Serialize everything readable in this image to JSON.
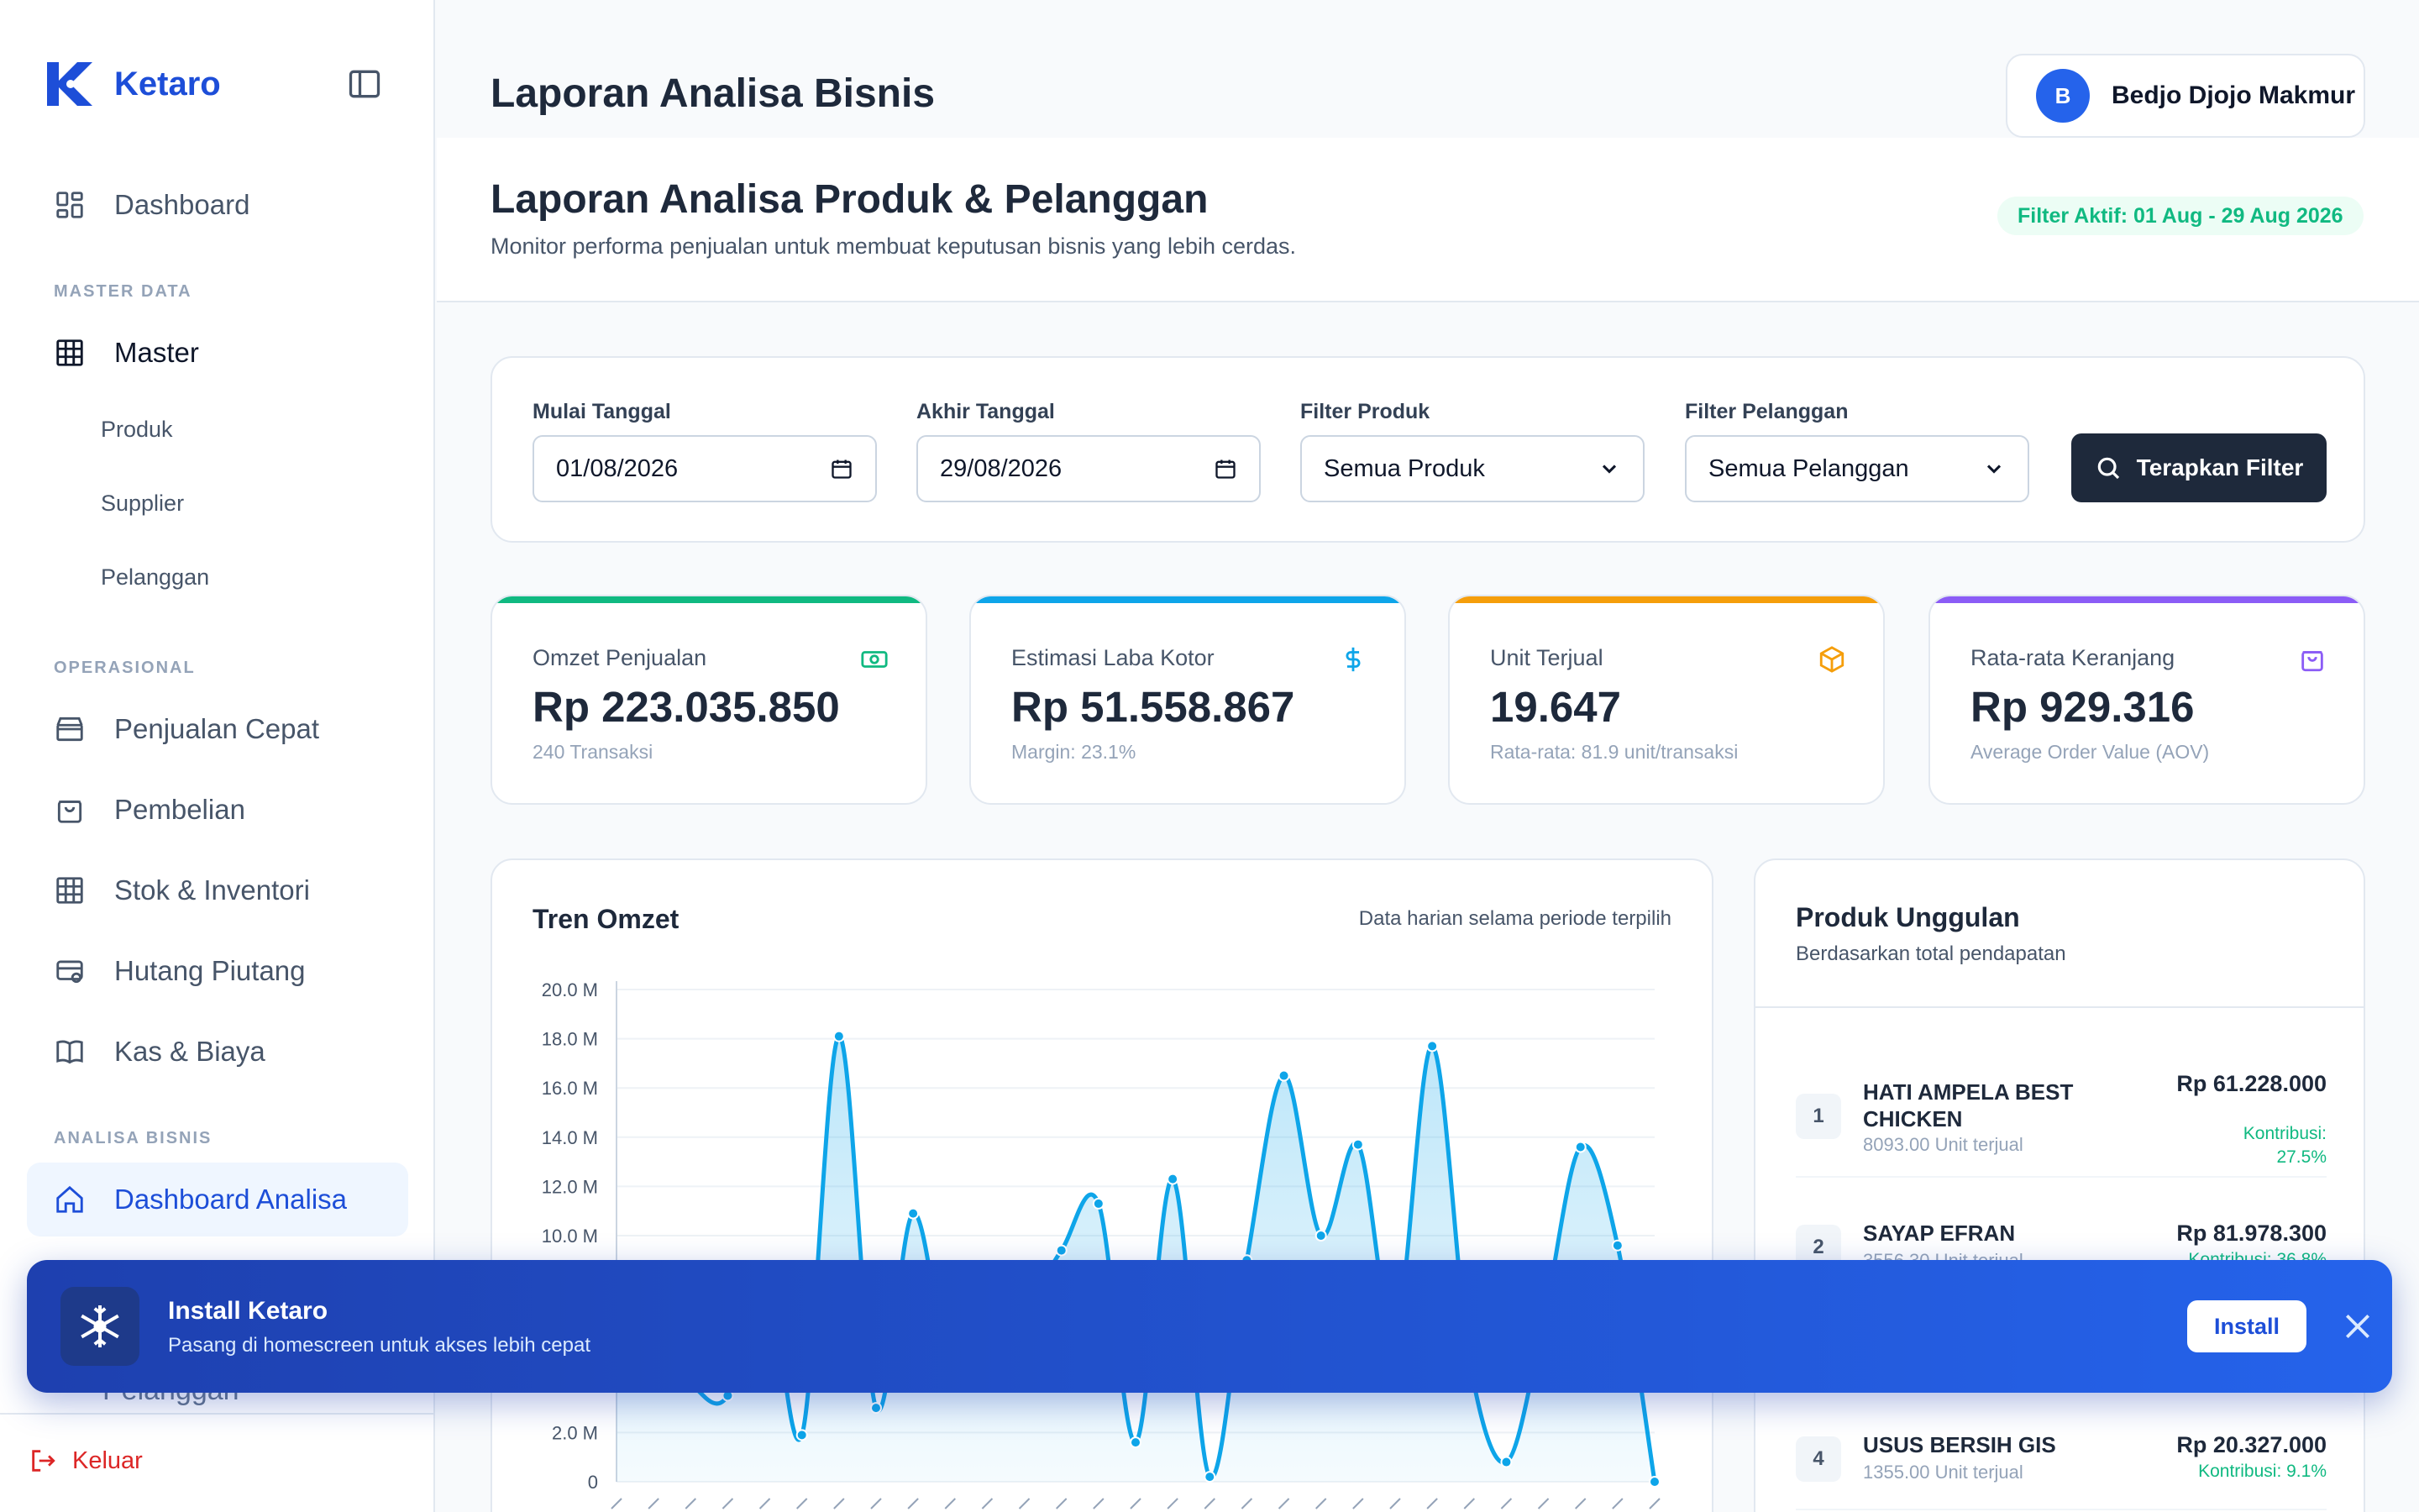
{
  "brand": {
    "name": "Ketaro"
  },
  "sidebar": {
    "dashboard": "Dashboard",
    "section_master": "MASTER DATA",
    "master": "Master",
    "master_sub": [
      "Produk",
      "Supplier",
      "Pelanggan"
    ],
    "section_operasional": "OPERASIONAL",
    "operasional": [
      "Penjualan Cepat",
      "Pembelian",
      "Stok & Inventori",
      "Hutang Piutang",
      "Kas & Biaya"
    ],
    "section_analisa": "ANALISA BISNIS",
    "analisa_active": "Dashboard Analisa",
    "analisa_hidden": "Pelanggan",
    "logout": "Keluar"
  },
  "header": {
    "title": "Laporan Analisa Bisnis",
    "user_initial": "B",
    "user_name": "Bedjo Djojo Makmur"
  },
  "subheader": {
    "title": "Laporan Analisa Produk & Pelanggan",
    "description": "Monitor performa penjualan untuk membuat keputusan bisnis yang lebih cerdas.",
    "filter_badge": "Filter Aktif: 01 Aug - 29 Aug 2026"
  },
  "filters": {
    "start_label": "Mulai Tanggal",
    "start_value": "01/08/2026",
    "end_label": "Akhir Tanggal",
    "end_value": "29/08/2026",
    "product_label": "Filter Produk",
    "product_value": "Semua Produk",
    "customer_label": "Filter Pelanggan",
    "customer_value": "Semua Pelanggan",
    "apply_label": "Terapkan Filter"
  },
  "kpis": [
    {
      "label": "Omzet Penjualan",
      "value": "Rp 223.035.850",
      "sub": "240 Transaksi",
      "color": "#10b981",
      "icon": "cash-icon"
    },
    {
      "label": "Estimasi Laba Kotor",
      "value": "Rp 51.558.867",
      "sub": "Margin: 23.1%",
      "color": "#0ea5e9",
      "icon": "dollar-icon"
    },
    {
      "label": "Unit Terjual",
      "value": "19.647",
      "sub": "Rata-rata: 81.9 unit/transaksi",
      "color": "#f59e0b",
      "icon": "box-icon"
    },
    {
      "label": "Rata-rata Keranjang",
      "value": "Rp 929.316",
      "sub": "Average Order Value (AOV)",
      "color": "#8b5cf6",
      "icon": "bag-icon"
    }
  ],
  "chart": {
    "title": "Tren Omzet",
    "note": "Data harian selama periode terpilih"
  },
  "chart_data": {
    "type": "area",
    "title": "Tren Omzet",
    "y_ticks": [
      "0",
      "2.0 M",
      "4.0 M",
      "6.0 M",
      "8.0 M",
      "10.0 M",
      "12.0 M",
      "14.0 M",
      "16.0 M",
      "18.0 M",
      "20.0 M"
    ],
    "ylim": [
      0,
      20000000
    ],
    "grid": true,
    "series": [
      {
        "values": [
          4500000,
          6000000,
          4000000,
          3500000,
          8800000,
          1900000,
          18100000,
          3000000,
          10900000,
          4500000,
          6000000,
          7000000,
          9400000,
          11300000,
          1600000,
          12300000,
          200000,
          9000000,
          16500000,
          10000000,
          13700000,
          6000000,
          17700000,
          5000000,
          800000,
          6500000,
          13600000,
          9600000,
          0
        ]
      }
    ],
    "color": "#0ea5e9"
  },
  "top_products": {
    "title": "Produk Unggulan",
    "subtitle": "Berdasarkan total pendapatan",
    "items": [
      {
        "rank": "1",
        "name": "HATI AMPELA BEST CHICKEN",
        "units": "8093.00 Unit terjual",
        "revenue": "Rp 61.228.000",
        "contribution": "Kontribusi: 27.5%"
      },
      {
        "rank": "2",
        "name": "SAYAP EFRAN",
        "units": "3556.30 Unit terjual",
        "revenue": "Rp 81.978.300",
        "contribution": "Kontribusi: 36.8%"
      },
      {
        "rank": "4",
        "name": "USUS BERSIH GIS",
        "units": "1355.00 Unit terjual",
        "revenue": "Rp 20.327.000",
        "contribution": "Kontribusi: 9.1%"
      }
    ]
  },
  "install_banner": {
    "title": "Install Ketaro",
    "description": "Pasang di homescreen untuk akses lebih cepat",
    "button": "Install"
  }
}
